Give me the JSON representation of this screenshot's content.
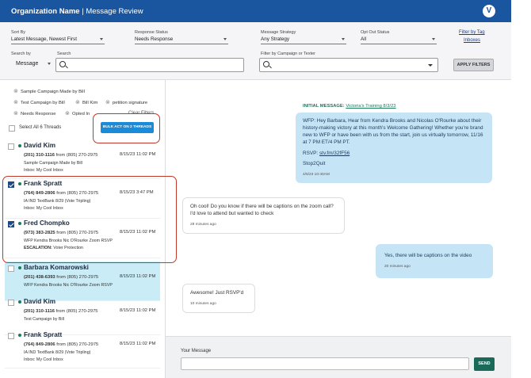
{
  "header": {
    "org": "Organization Name",
    "separator": " | ",
    "page": "Message Review",
    "avatar": "V"
  },
  "filters": {
    "sort_by": {
      "label": "Sort By",
      "value": "Latest Message, Newest First"
    },
    "response_status": {
      "label": "Response Status",
      "value": "Needs Response"
    },
    "message_strategy": {
      "label": "Message Strategy",
      "value": "Any Strategy"
    },
    "opt_out_status": {
      "label": "Opt Out Status",
      "value": "All"
    },
    "filter_by_tag": "Filter by Tag",
    "inboxes": "Inboxes",
    "search_by": {
      "label": "Search by",
      "value": "Message"
    },
    "search": {
      "label": "Search",
      "placeholder": ""
    },
    "campaign_filter": {
      "label": "Filter by Campaign or Texter",
      "placeholder": ""
    },
    "apply_button": "APPLY FILTERS"
  },
  "chips": [
    "Sample Campaign Made by Bill",
    "Test Campaign by Bill",
    "Bill Kim",
    "petition signature",
    "Needs Response",
    "Opted In"
  ],
  "clear_filters": "Clear Filters",
  "select_all": "Select All 6 Threads",
  "bulk_button": "BULK ACT ON 2 THREADS",
  "threads": [
    {
      "name": "David Kim",
      "to": "(201) 310-1116",
      "from_label": "from",
      "from": "(805) 270-2975",
      "date": "8/15/23 11:02 PM",
      "campaign": "Sample Campaign Made by Bill",
      "inbox": "Inbox: My Cool Inbox",
      "checked": false,
      "active": false
    },
    {
      "name": "Frank Spratt",
      "to": "(764) 849-2806",
      "from_label": "from",
      "from": "(805) 270-2975",
      "date": "8/15/23 3:47 PM",
      "campaign": "IA IND TextBank 8/29 (Vote Tripling)",
      "inbox": "Inbox: My Cool Inbox",
      "checked": true,
      "active": false
    },
    {
      "name": "Fred Chompko",
      "to": "(973) 383-2825",
      "from_label": "from",
      "from": "(805) 270-2975",
      "date": "8/15/23 11:02 PM",
      "campaign": "WFP Kendra Brooks Nic O'Rourke Zoom RSVP",
      "escalation_label": "ESCALATION:",
      "escalation": "Voter Protection",
      "checked": true,
      "active": false
    },
    {
      "name": "Barbara Komarowski",
      "to": "(201) 438-6393",
      "from_label": "from",
      "from": "(805) 270-2975",
      "date": "8/15/23 11:02 PM",
      "campaign": "WFP Kendra Brooks Nic O'Rourke Zoom RSVP",
      "inbox": "",
      "checked": false,
      "active": true
    },
    {
      "name": "David Kim",
      "to": "(201) 310-1116",
      "from_label": "from",
      "from": "(805) 270-2975",
      "date": "8/15/23 11:02 PM",
      "campaign": "Test Campaign by Bill",
      "inbox": "",
      "checked": false,
      "active": false
    },
    {
      "name": "Frank Spratt",
      "to": "(764) 849-2806",
      "from_label": "from",
      "from": "(805) 270-2975",
      "date": "8/15/23 11:02 PM",
      "campaign": "IA IND TextBank 8/29 (Vote Tripling)",
      "inbox": "Inbox: My Cool Inbox",
      "checked": false,
      "active": false
    }
  ],
  "conversation": {
    "initial_label": "INITIAL MESSAGE:",
    "initial_campaign": "Victoria's Training 8/3/23",
    "messages": [
      {
        "dir": "out",
        "text": "WFP: Hey Barbara, Hear from Kendra Brooks and Nicolas O'Rourke about their history-making victory at this month's Welcome Gathering! Whether you're brand new to WFP or have been with us from the start, join us virtually tomorrow, 11/16 at 7 PM ET/4 PM PT.",
        "rsvp_label": "RSVP:",
        "rsvp_link": "stv.fm/32fF56",
        "extra": "Stop2Quit",
        "time": "4/5/23 10:40AM"
      },
      {
        "dir": "in",
        "text": "Oh cool! Do you know if there will be captions on the zoom call? I'd love to attend but wanted to check",
        "time": "28 minutes ago"
      },
      {
        "dir": "out",
        "text": "Yes, there will be captions on the video",
        "time": "20 minutes ago"
      },
      {
        "dir": "in",
        "text": "Awesome! Just RSVP'd",
        "time": "10 minutes ago"
      }
    ]
  },
  "compose": {
    "label": "Your Message",
    "placeholder": "",
    "send": "SEND"
  },
  "colors": {
    "header": "#1a56a0",
    "accent_green": "#1a7a5a",
    "bulk_button": "#1a8bd8",
    "annotation": "#c0392b",
    "out_bubble": "#c5e5f7"
  }
}
